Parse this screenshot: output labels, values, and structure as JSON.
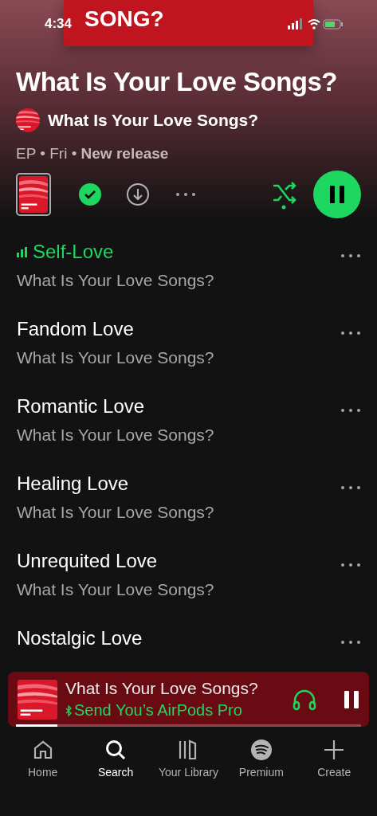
{
  "status_bar": {
    "time": "4:34"
  },
  "cover_banner": {
    "text": "SONG?"
  },
  "album": {
    "title": "What Is Your Love Songs?",
    "artist": "What Is Your Love Songs?",
    "meta": "EP • Fri • ",
    "meta_bold": "New release",
    "saved": true,
    "shuffle": true,
    "playing": true
  },
  "tracks": [
    {
      "title": "Self-Love",
      "subtitle": "What Is Your Love Songs?",
      "playing": true
    },
    {
      "title": "Fandom Love",
      "subtitle": "What Is Your Love Songs?",
      "playing": false
    },
    {
      "title": "Romantic Love",
      "subtitle": "What Is Your Love Songs?",
      "playing": false
    },
    {
      "title": "Healing Love",
      "subtitle": "What Is Your Love Songs?",
      "playing": false
    },
    {
      "title": "Unrequited Love",
      "subtitle": "What Is Your Love Songs?",
      "playing": false
    },
    {
      "title": "Nostalgic Love",
      "playing": false
    }
  ],
  "mini_player": {
    "title": "Vhat Is Your Love Songs?",
    "device": "Send You’s AirPods Pro",
    "playing": true,
    "level": 0.12
  },
  "nav": [
    {
      "label": "Home",
      "kind": "home",
      "selected": false
    },
    {
      "label": "Search",
      "kind": "search",
      "selected": true
    },
    {
      "label": "Your Library",
      "kind": "library",
      "selected": false
    },
    {
      "label": "Premium",
      "kind": "premium",
      "selected": false
    },
    {
      "label": "Create",
      "kind": "create",
      "selected": false
    }
  ]
}
